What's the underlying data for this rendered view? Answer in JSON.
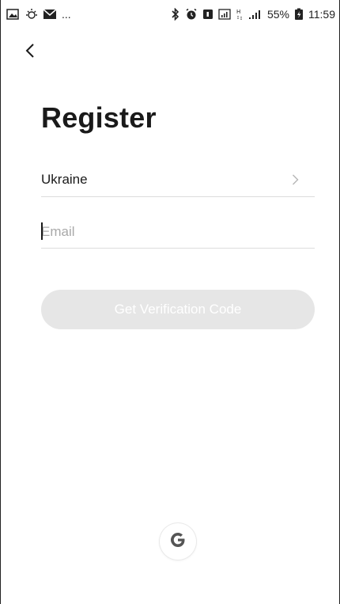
{
  "status_bar": {
    "battery": "55%",
    "time": "11:59",
    "left_dots": "..."
  },
  "register": {
    "title": "Register",
    "country": "Ukraine",
    "email_placeholder": "Email",
    "email_value": "",
    "verify_label": "Get Verification Code"
  },
  "icons": {
    "back": "back-arrow-icon",
    "chevron": "chevron-right-icon",
    "google": "google-logo-icon"
  },
  "colors": {
    "button_disabled": "#e6e6e6",
    "divider": "#dcdcdc",
    "placeholder": "#a9a9a9"
  }
}
